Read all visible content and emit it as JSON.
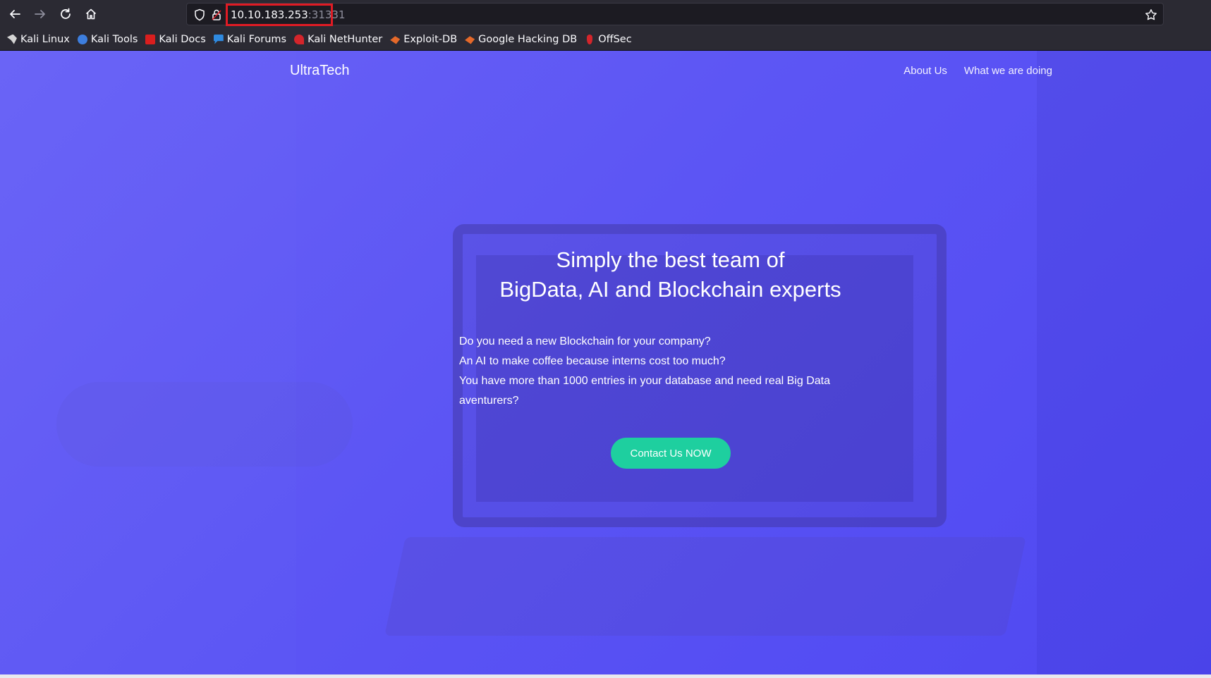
{
  "browser": {
    "nav": {
      "back_icon": "arrow-left-icon",
      "forward_icon": "arrow-right-icon",
      "reload_icon": "reload-icon",
      "home_icon": "home-icon"
    },
    "url": {
      "host": "10.10.183.253",
      "port": ":31331",
      "highlight_color": "#e01b24"
    },
    "bookmarks": [
      {
        "label": "Kali Linux",
        "icon": "kali-dragon-icon",
        "color": "#d5d5d5"
      },
      {
        "label": "Kali Tools",
        "icon": "kali-tools-icon",
        "color": "#3d7ede"
      },
      {
        "label": "Kali Docs",
        "icon": "kali-docs-icon",
        "color": "#d91e1e"
      },
      {
        "label": "Kali Forums",
        "icon": "kali-forums-icon",
        "color": "#2f8ae0"
      },
      {
        "label": "Kali NetHunter",
        "icon": "nethunter-icon",
        "color": "#d4252b"
      },
      {
        "label": "Exploit-DB",
        "icon": "exploit-db-icon",
        "color": "#e5692a"
      },
      {
        "label": "Google Hacking DB",
        "icon": "ghdb-icon",
        "color": "#e5692a"
      },
      {
        "label": "OffSec",
        "icon": "offsec-icon",
        "color": "#d4252b"
      }
    ]
  },
  "site": {
    "brand": "UltraTech",
    "nav": [
      "About Us",
      "What we are doing"
    ],
    "headline": [
      "Simply the best team of",
      "BigData, AI and Blockchain experts"
    ],
    "body": [
      "Do you need a new Blockchain for your company?",
      "An AI to make coffee because interns cost too much?",
      "You have more than 1000 entries in your database and need real Big Data",
      "aventurers?"
    ],
    "cta": "Contact Us NOW",
    "accent_color": "#1ecf9f",
    "background_color": "#5c55f4"
  }
}
